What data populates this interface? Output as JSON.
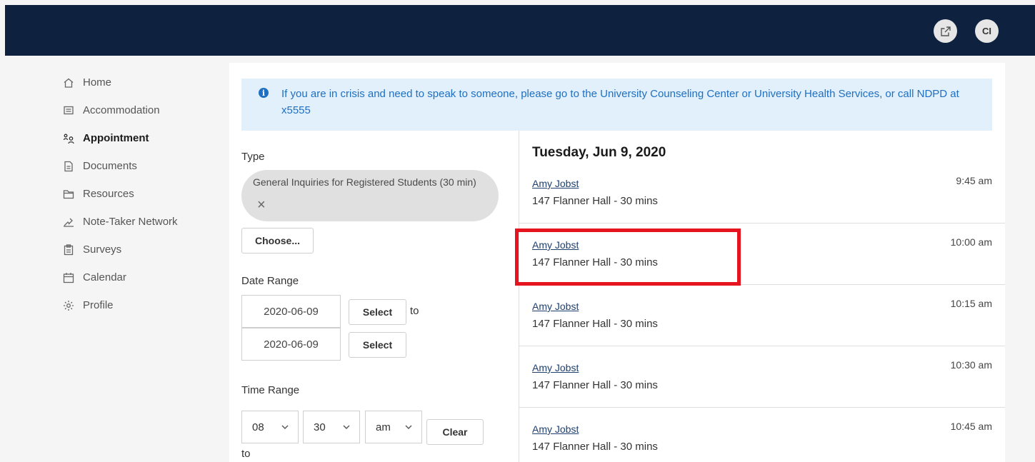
{
  "header": {
    "external_icon": "external-link-icon",
    "avatar_initials": "CI"
  },
  "sidebar": {
    "items": [
      {
        "label": "Home",
        "icon": "home-icon"
      },
      {
        "label": "Accommodation",
        "icon": "message-icon"
      },
      {
        "label": "Appointment",
        "icon": "people-icon",
        "active": true
      },
      {
        "label": "Documents",
        "icon": "document-icon"
      },
      {
        "label": "Resources",
        "icon": "folder-icon"
      },
      {
        "label": "Note-Taker Network",
        "icon": "note-icon"
      },
      {
        "label": "Surveys",
        "icon": "clipboard-icon"
      },
      {
        "label": "Calendar",
        "icon": "calendar-icon"
      },
      {
        "label": "Profile",
        "icon": "gear-icon"
      }
    ]
  },
  "alert": {
    "text": "If you are in crisis and need to speak to someone, please go to the University Counseling Center or University Health Services, or call NDPD at x5555"
  },
  "filters": {
    "type_label": "Type",
    "type_chip": "General Inquiries for Registered Students (30 min)",
    "remove_symbol": "×",
    "choose_label": "Choose...",
    "date_range_label": "Date Range",
    "date_from": "2020-06-09",
    "date_to": "2020-06-09",
    "select_label": "Select",
    "to_label": "to",
    "time_range_label": "Time Range",
    "hour": "08",
    "minute": "30",
    "meridiem": "am",
    "clear_label": "Clear"
  },
  "schedule": {
    "day_title": "Tuesday, Jun 9, 2020",
    "slots": [
      {
        "name": "Amy Jobst",
        "location": "147 Flanner Hall - 30 mins",
        "time": "9:45 am"
      },
      {
        "name": "Amy Jobst",
        "location": "147 Flanner Hall - 30 mins",
        "time": "10:00 am"
      },
      {
        "name": "Amy Jobst",
        "location": "147 Flanner Hall - 30 mins",
        "time": "10:15 am"
      },
      {
        "name": "Amy Jobst",
        "location": "147 Flanner Hall - 30 mins",
        "time": "10:30 am"
      },
      {
        "name": "Amy Jobst",
        "location": "147 Flanner Hall - 30 mins",
        "time": "10:45 am"
      }
    ]
  },
  "colors": {
    "header_bg": "#0e2240",
    "alert_bg": "#e1f0fb",
    "alert_text": "#1f6fc2",
    "highlight": "#e5141f"
  }
}
